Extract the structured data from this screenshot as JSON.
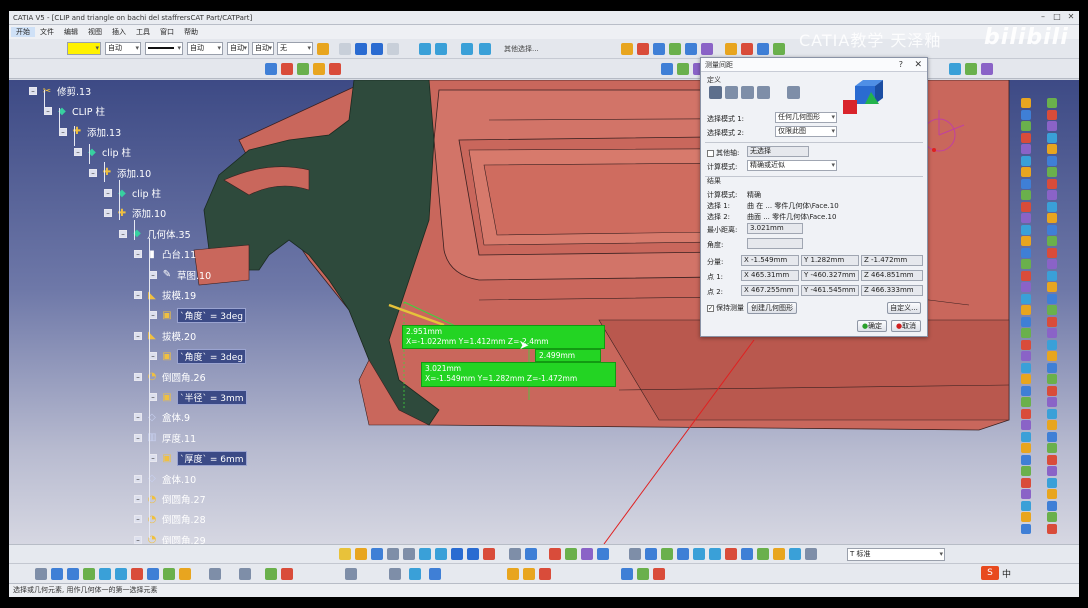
{
  "window": {
    "title": "CATIA V5 - [CLIP and triangle on bachi del staffrersCAT Part/CATPart]",
    "minimize": "–",
    "maximize": "□",
    "close": "✕"
  },
  "menu": [
    "开始",
    "文件",
    "编辑",
    "视图",
    "插入",
    "工具",
    "窗口",
    "帮助"
  ],
  "toolbar": {
    "color_combo": "",
    "line_type_combo": "自动",
    "line_weight_combo": "",
    "thickness_combo": "自动",
    "layer_combo": "自动",
    "layer2_combo": "自动",
    "layer3_combo": "无",
    "selection_label": "其他选择..."
  },
  "tree": {
    "nodes": [
      {
        "label": "修剪.13",
        "icon": "trim-icon"
      },
      {
        "label": "CLIP 柱",
        "icon": "geoset-icon"
      },
      {
        "label": "添加.13",
        "icon": "add-icon"
      },
      {
        "label": "clip 柱",
        "icon": "geoset-icon"
      },
      {
        "label": "添加.10",
        "icon": "add-icon"
      },
      {
        "label": "clip 柱",
        "icon": "geoset-icon"
      },
      {
        "label": "添加.10",
        "icon": "add-icon"
      },
      {
        "label": "几何体.35",
        "icon": "body-icon"
      },
      {
        "label": "凸台.11",
        "icon": "pad-icon"
      },
      {
        "label": "草图.10",
        "icon": "sketch-icon"
      },
      {
        "label": "拔模.19",
        "icon": "draft-icon"
      },
      {
        "label": "`角度` = 3deg",
        "icon": "param-icon"
      },
      {
        "label": "拔模.20",
        "icon": "draft-icon"
      },
      {
        "label": "`角度` = 3deg",
        "icon": "param-icon"
      },
      {
        "label": "倒圆角.26",
        "icon": "fillet-icon"
      },
      {
        "label": "`半径` = 3mm",
        "icon": "param-icon"
      },
      {
        "label": "盒体.9",
        "icon": "shell-icon"
      },
      {
        "label": "厚度.11",
        "icon": "thickness-icon"
      },
      {
        "label": "`厚度` = 6mm",
        "icon": "param-icon"
      },
      {
        "label": "盒体.10",
        "icon": "shell-icon"
      },
      {
        "label": "倒圆角.27",
        "icon": "fillet-icon"
      },
      {
        "label": "倒圆角.28",
        "icon": "fillet-icon"
      },
      {
        "label": "倒圆角.29",
        "icon": "fillet-icon"
      }
    ]
  },
  "measure": {
    "box1_line1": "2.951mm",
    "box1_line2": "X=-1.022mm  Y=1.412mm  Z=-2.4mm",
    "box2_line1": "2.499mm",
    "box3_line1": "3.021mm",
    "box3_line2": "X=-1.549mm  Y=1.282mm  Z=-1.472mm"
  },
  "dialog": {
    "title": "测量间距",
    "q": "?",
    "x": "✕",
    "definition_label": "定义",
    "select_mode1_label": "选择模式 1:",
    "select_mode1_value": "任何几何图形",
    "select_mode2_label": "选择模式 2:",
    "select_mode2_value": "仅限此图",
    "other_axis_label": "其他轴:",
    "other_axis_value": "无选择",
    "calc_mode_label": "计算模式:",
    "calc_mode_value": "精确或近似",
    "result_label": "结果",
    "calc_mode_result_label": "计算模式:",
    "calc_mode_result_value": "精确",
    "selection1_label": "选择 1:",
    "selection1_value": "曲 在 ... 零件几何体\\Face.10",
    "selection2_label": "选择 2:",
    "selection2_value": "曲面 ... 零件几何体\\Face.10",
    "min_dist_label": "最小距离:",
    "min_dist_value": "3.021mm",
    "angle_label": "角度:",
    "angle_value": "",
    "components_label": "分量:",
    "comp_x": "X -1.549mm",
    "comp_y": "Y 1.282mm",
    "comp_z": "Z -1.472mm",
    "point1_label": "点 1:",
    "p1_x": "X 465.31mm",
    "p1_y": "Y -460.327mm",
    "p1_z": "Z 464.851mm",
    "point2_label": "点 2:",
    "p2_x": "X 467.255mm",
    "p2_y": "Y -461.545mm",
    "p2_z": "Z 466.333mm",
    "keep_measure_label": "保持测量",
    "create_geometry_button": "创建几何图形",
    "customize_button": "自定义...",
    "ok_button": "确定",
    "cancel_button": "取消"
  },
  "bottom": {
    "layer_combo": "T 标准",
    "ime_label": "中"
  },
  "status": {
    "text": "选择或几何元素, 用作几何体一的第一选择元素"
  },
  "overlay": {
    "watermark": "CATIA教学  天泽釉",
    "bilibili": "bilibili"
  },
  "colors": {
    "part_body": "#c9675c",
    "part_dark": "#2e4a3c",
    "measure_green": "#23d423",
    "viewport_top": "#3d4a85",
    "viewport_bottom": "#d6d7e2"
  }
}
